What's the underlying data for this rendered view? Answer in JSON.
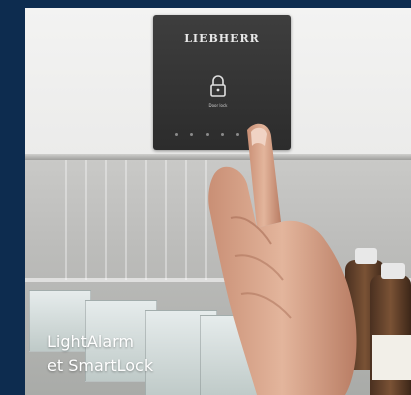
{
  "panel": {
    "brand": "LIEBHERR",
    "lock_text": "Door lock"
  },
  "caption": {
    "line1": "LightAlarm",
    "line2": "et SmartLock"
  },
  "colors": {
    "background": "#0d2c4f",
    "panel": "#333333",
    "caption_text": "#ffffff"
  },
  "icons": {
    "lock": "lock-icon"
  }
}
